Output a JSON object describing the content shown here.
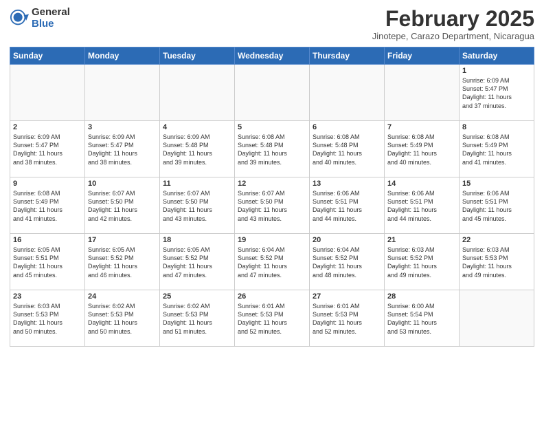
{
  "logo": {
    "general": "General",
    "blue": "Blue"
  },
  "title": "February 2025",
  "location": "Jinotepe, Carazo Department, Nicaragua",
  "weekdays": [
    "Sunday",
    "Monday",
    "Tuesday",
    "Wednesday",
    "Thursday",
    "Friday",
    "Saturday"
  ],
  "weeks": [
    [
      {
        "day": "",
        "info": ""
      },
      {
        "day": "",
        "info": ""
      },
      {
        "day": "",
        "info": ""
      },
      {
        "day": "",
        "info": ""
      },
      {
        "day": "",
        "info": ""
      },
      {
        "day": "",
        "info": ""
      },
      {
        "day": "1",
        "info": "Sunrise: 6:09 AM\nSunset: 5:47 PM\nDaylight: 11 hours\nand 37 minutes."
      }
    ],
    [
      {
        "day": "2",
        "info": "Sunrise: 6:09 AM\nSunset: 5:47 PM\nDaylight: 11 hours\nand 38 minutes."
      },
      {
        "day": "3",
        "info": "Sunrise: 6:09 AM\nSunset: 5:47 PM\nDaylight: 11 hours\nand 38 minutes."
      },
      {
        "day": "4",
        "info": "Sunrise: 6:09 AM\nSunset: 5:48 PM\nDaylight: 11 hours\nand 39 minutes."
      },
      {
        "day": "5",
        "info": "Sunrise: 6:08 AM\nSunset: 5:48 PM\nDaylight: 11 hours\nand 39 minutes."
      },
      {
        "day": "6",
        "info": "Sunrise: 6:08 AM\nSunset: 5:48 PM\nDaylight: 11 hours\nand 40 minutes."
      },
      {
        "day": "7",
        "info": "Sunrise: 6:08 AM\nSunset: 5:49 PM\nDaylight: 11 hours\nand 40 minutes."
      },
      {
        "day": "8",
        "info": "Sunrise: 6:08 AM\nSunset: 5:49 PM\nDaylight: 11 hours\nand 41 minutes."
      }
    ],
    [
      {
        "day": "9",
        "info": "Sunrise: 6:08 AM\nSunset: 5:49 PM\nDaylight: 11 hours\nand 41 minutes."
      },
      {
        "day": "10",
        "info": "Sunrise: 6:07 AM\nSunset: 5:50 PM\nDaylight: 11 hours\nand 42 minutes."
      },
      {
        "day": "11",
        "info": "Sunrise: 6:07 AM\nSunset: 5:50 PM\nDaylight: 11 hours\nand 43 minutes."
      },
      {
        "day": "12",
        "info": "Sunrise: 6:07 AM\nSunset: 5:50 PM\nDaylight: 11 hours\nand 43 minutes."
      },
      {
        "day": "13",
        "info": "Sunrise: 6:06 AM\nSunset: 5:51 PM\nDaylight: 11 hours\nand 44 minutes."
      },
      {
        "day": "14",
        "info": "Sunrise: 6:06 AM\nSunset: 5:51 PM\nDaylight: 11 hours\nand 44 minutes."
      },
      {
        "day": "15",
        "info": "Sunrise: 6:06 AM\nSunset: 5:51 PM\nDaylight: 11 hours\nand 45 minutes."
      }
    ],
    [
      {
        "day": "16",
        "info": "Sunrise: 6:05 AM\nSunset: 5:51 PM\nDaylight: 11 hours\nand 45 minutes."
      },
      {
        "day": "17",
        "info": "Sunrise: 6:05 AM\nSunset: 5:52 PM\nDaylight: 11 hours\nand 46 minutes."
      },
      {
        "day": "18",
        "info": "Sunrise: 6:05 AM\nSunset: 5:52 PM\nDaylight: 11 hours\nand 47 minutes."
      },
      {
        "day": "19",
        "info": "Sunrise: 6:04 AM\nSunset: 5:52 PM\nDaylight: 11 hours\nand 47 minutes."
      },
      {
        "day": "20",
        "info": "Sunrise: 6:04 AM\nSunset: 5:52 PM\nDaylight: 11 hours\nand 48 minutes."
      },
      {
        "day": "21",
        "info": "Sunrise: 6:03 AM\nSunset: 5:52 PM\nDaylight: 11 hours\nand 49 minutes."
      },
      {
        "day": "22",
        "info": "Sunrise: 6:03 AM\nSunset: 5:53 PM\nDaylight: 11 hours\nand 49 minutes."
      }
    ],
    [
      {
        "day": "23",
        "info": "Sunrise: 6:03 AM\nSunset: 5:53 PM\nDaylight: 11 hours\nand 50 minutes."
      },
      {
        "day": "24",
        "info": "Sunrise: 6:02 AM\nSunset: 5:53 PM\nDaylight: 11 hours\nand 50 minutes."
      },
      {
        "day": "25",
        "info": "Sunrise: 6:02 AM\nSunset: 5:53 PM\nDaylight: 11 hours\nand 51 minutes."
      },
      {
        "day": "26",
        "info": "Sunrise: 6:01 AM\nSunset: 5:53 PM\nDaylight: 11 hours\nand 52 minutes."
      },
      {
        "day": "27",
        "info": "Sunrise: 6:01 AM\nSunset: 5:53 PM\nDaylight: 11 hours\nand 52 minutes."
      },
      {
        "day": "28",
        "info": "Sunrise: 6:00 AM\nSunset: 5:54 PM\nDaylight: 11 hours\nand 53 minutes."
      },
      {
        "day": "",
        "info": ""
      }
    ]
  ]
}
